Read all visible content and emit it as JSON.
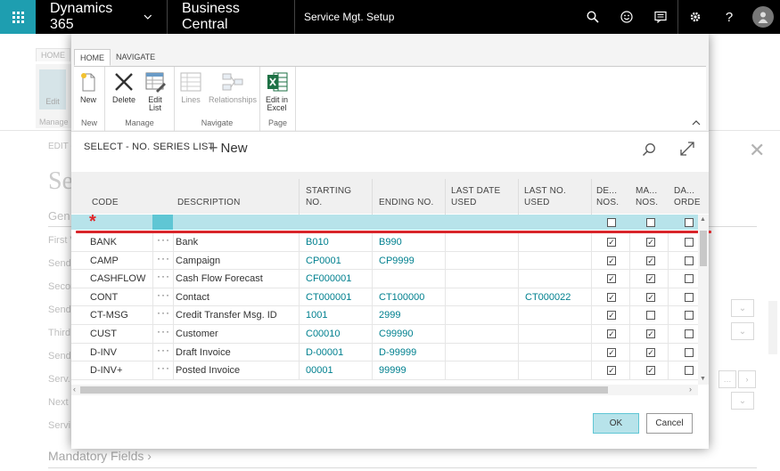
{
  "topbar": {
    "app": "Dynamics 365",
    "product": "Business Central",
    "page": "Service Mgt. Setup",
    "icons": [
      "waffle-icon",
      "search-icon",
      "smiley-icon",
      "chat-icon",
      "gear-icon",
      "help-icon",
      "avatar-icon"
    ]
  },
  "background": {
    "tabs": [
      "HOME",
      "NAVIGATE"
    ],
    "edit_label": "Edit",
    "manage_label": "Manage",
    "edit_header": "EDIT -",
    "title": "Se",
    "general": "Gen",
    "rows": [
      "First V",
      "Send",
      "Secon",
      "Send",
      "Third",
      "Send",
      "Serv.",
      "Next",
      "Servi"
    ],
    "mandatory_fields": "Mandatory Fields"
  },
  "ribbon": {
    "tabs": [
      "HOME",
      "NAVIGATE"
    ],
    "new_group": {
      "label": "New",
      "buttons": [
        {
          "label": "New"
        }
      ]
    },
    "manage_group": {
      "label": "Manage",
      "buttons": [
        {
          "label": "Delete"
        },
        {
          "label": "Edit\nList"
        }
      ]
    },
    "navigate_group": {
      "label": "Navigate",
      "buttons": [
        {
          "label": "Lines"
        },
        {
          "label": "Relationships"
        }
      ]
    },
    "page_group": {
      "label": "Page",
      "buttons": [
        {
          "label": "Edit in\nExcel"
        }
      ]
    }
  },
  "header": {
    "caption": "SELECT - NO. SERIES LIST",
    "new_label": "New"
  },
  "grid": {
    "columns": [
      "CODE",
      "DESCRIPTION",
      "STARTING\nNO.",
      "ENDING NO.",
      "LAST DATE\nUSED",
      "LAST NO.\nUSED",
      "DE...\nNOS.",
      "MA...\nNOS.",
      "DA...\nORDE"
    ],
    "rows": [
      {
        "code": "BANK",
        "description": "Bank",
        "starting": "B010",
        "ending": "B990",
        "last_date": "",
        "last_no": "",
        "def": true,
        "man": true,
        "date": false
      },
      {
        "code": "CAMP",
        "description": "Campaign",
        "starting": "CP0001",
        "ending": "CP9999",
        "last_date": "",
        "last_no": "",
        "def": true,
        "man": true,
        "date": false
      },
      {
        "code": "CASHFLOW",
        "description": "Cash Flow Forecast",
        "starting": "CF000001",
        "ending": "",
        "last_date": "",
        "last_no": "",
        "def": true,
        "man": true,
        "date": false
      },
      {
        "code": "CONT",
        "description": "Contact",
        "starting": "CT000001",
        "ending": "CT100000",
        "last_date": "",
        "last_no": "CT000022",
        "def": true,
        "man": true,
        "date": false
      },
      {
        "code": "CT-MSG",
        "description": "Credit Transfer Msg. ID",
        "starting": "1001",
        "ending": "2999",
        "last_date": "",
        "last_no": "",
        "def": true,
        "man": false,
        "date": false
      },
      {
        "code": "CUST",
        "description": "Customer",
        "starting": "C00010",
        "ending": "C99990",
        "last_date": "",
        "last_no": "",
        "def": true,
        "man": true,
        "date": false
      },
      {
        "code": "D-INV",
        "description": "Draft Invoice",
        "starting": "D-00001",
        "ending": "D-99999",
        "last_date": "",
        "last_no": "",
        "def": true,
        "man": true,
        "date": false
      },
      {
        "code": "D-INV+",
        "description": "Posted Invoice",
        "starting": "00001",
        "ending": "99999",
        "last_date": "",
        "last_no": "",
        "def": true,
        "man": true,
        "date": false
      }
    ]
  },
  "footer": {
    "ok": "OK",
    "cancel": "Cancel"
  },
  "colors": {
    "accent": "#1e9eb0",
    "selected_row": "#b7e3ea",
    "selected_cell": "#5fc6d4",
    "link": "#00808f",
    "marker": "#d9252a"
  }
}
